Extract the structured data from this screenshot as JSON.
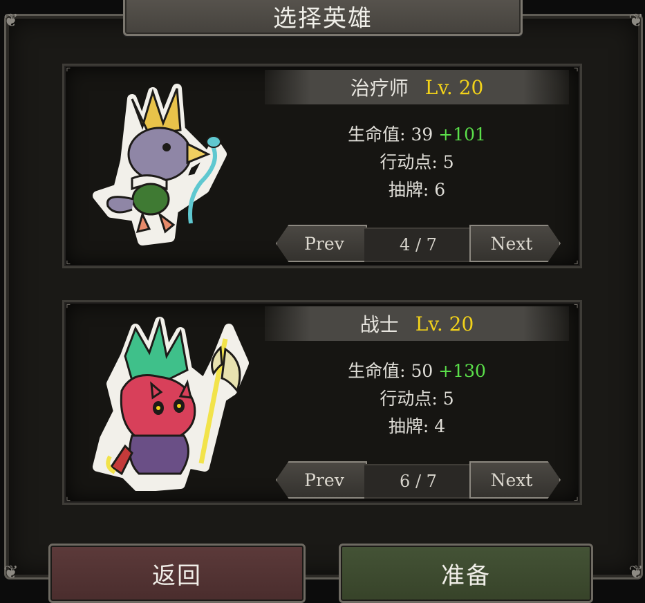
{
  "title": "选择英雄",
  "heroes": [
    {
      "name": "治疗师",
      "level": "Lv. 20",
      "hp_label": "生命值: 39",
      "hp_bonus": "+101",
      "ap": "行动点: 5",
      "draw": "抽牌: 6",
      "prev_label": "Prev",
      "page": "4 / 7",
      "next_label": "Next",
      "portrait_icon": "crowned-bird-healer-icon"
    },
    {
      "name": "战士",
      "level": "Lv. 20",
      "hp_label": "生命值: 50",
      "hp_bonus": "+130",
      "ap": "行动点: 5",
      "draw": "抽牌: 4",
      "prev_label": "Prev",
      "page": "6 / 7",
      "next_label": "Next",
      "portrait_icon": "red-demon-warrior-axe-icon"
    }
  ],
  "buttons": {
    "back": "返回",
    "ready": "准备"
  },
  "colors": {
    "level": "#f2d21a",
    "bonus": "#5be04a",
    "back_button": "#5c3a3a",
    "ready_button": "#445336"
  }
}
